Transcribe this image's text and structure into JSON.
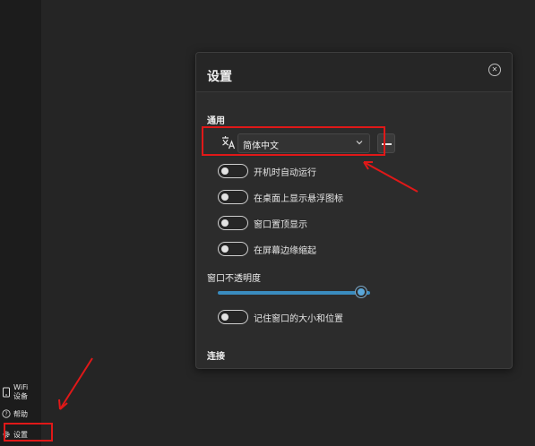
{
  "sidebar": {
    "wifi_label": "WiFi设备",
    "help_label": "帮助",
    "settings_label": "设置"
  },
  "settings": {
    "title": "设置",
    "general_label": "通用",
    "language_value": "简体中文",
    "toggles": [
      {
        "label": "开机时自动运行",
        "on": false
      },
      {
        "label": "在桌面上显示悬浮图标",
        "on": false
      },
      {
        "label": "窗口置顶显示",
        "on": false
      },
      {
        "label": "在屏幕边缘缩起",
        "on": false
      },
      {
        "label": "记住窗口的大小和位置",
        "on": false
      }
    ],
    "opacity_label": "窗口不透明度",
    "opacity_value_fraction": 1.0,
    "connect_label": "连接"
  },
  "colors": {
    "annotation_red": "#e01818",
    "accent_blue": "#3a8cbf"
  }
}
